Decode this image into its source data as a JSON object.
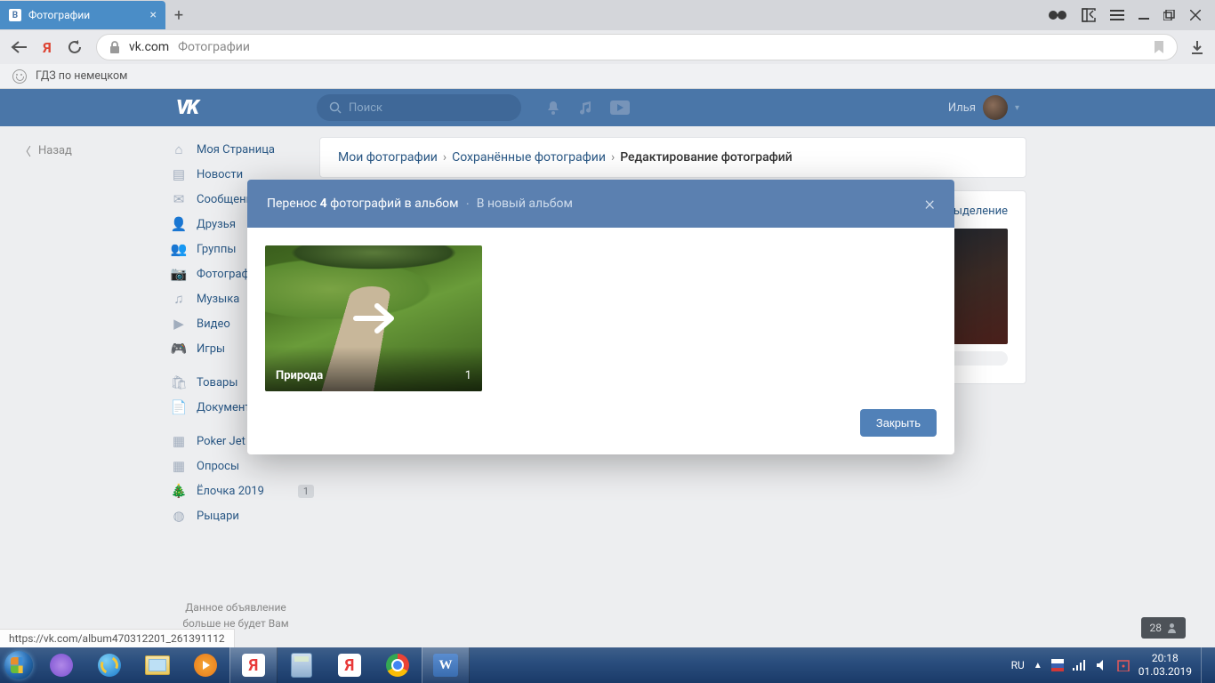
{
  "browser": {
    "tab_title": "Фотографии",
    "url_domain": "vk.com",
    "url_page": "Фотографии",
    "bookmark_label": "ГДЗ по немецком"
  },
  "vk_header": {
    "search_placeholder": "Поиск",
    "user_name": "Илья"
  },
  "back_label": "Назад",
  "sidebar": {
    "items": [
      {
        "label": "Моя Страница"
      },
      {
        "label": "Новости"
      },
      {
        "label": "Сообщения"
      },
      {
        "label": "Друзья"
      },
      {
        "label": "Группы"
      },
      {
        "label": "Фотографии"
      },
      {
        "label": "Музыка"
      },
      {
        "label": "Видео"
      },
      {
        "label": "Игры"
      }
    ],
    "items2": [
      {
        "label": "Товары"
      },
      {
        "label": "Документы"
      }
    ],
    "items3": [
      {
        "label": "Poker Jet"
      },
      {
        "label": "Опросы"
      },
      {
        "label": "Ёлочка 2019",
        "badge": "1"
      },
      {
        "label": "Рыцари"
      }
    ],
    "ad_line1": "Данное объявление",
    "ad_line2": "больше не будет Вам"
  },
  "breadcrumb": {
    "lvl1": "Мои фотографии",
    "lvl2": "Сохранённые фотографии",
    "lvl3": "Редактирование фотографий"
  },
  "mgmt": {
    "cancel_selection": "ыделение"
  },
  "modal": {
    "title_prefix": "Перенос ",
    "title_count": "4",
    "title_suffix": " фотографий в альбом",
    "new_album": "В новый альбом",
    "album_name": "Природа",
    "album_count": "1",
    "close_btn": "Закрыть"
  },
  "status_url": "https://vk.com/album470312201_261391112",
  "notification": {
    "count": "28"
  },
  "taskbar": {
    "lang": "RU",
    "time": "20:18",
    "date": "01.03.2019"
  }
}
